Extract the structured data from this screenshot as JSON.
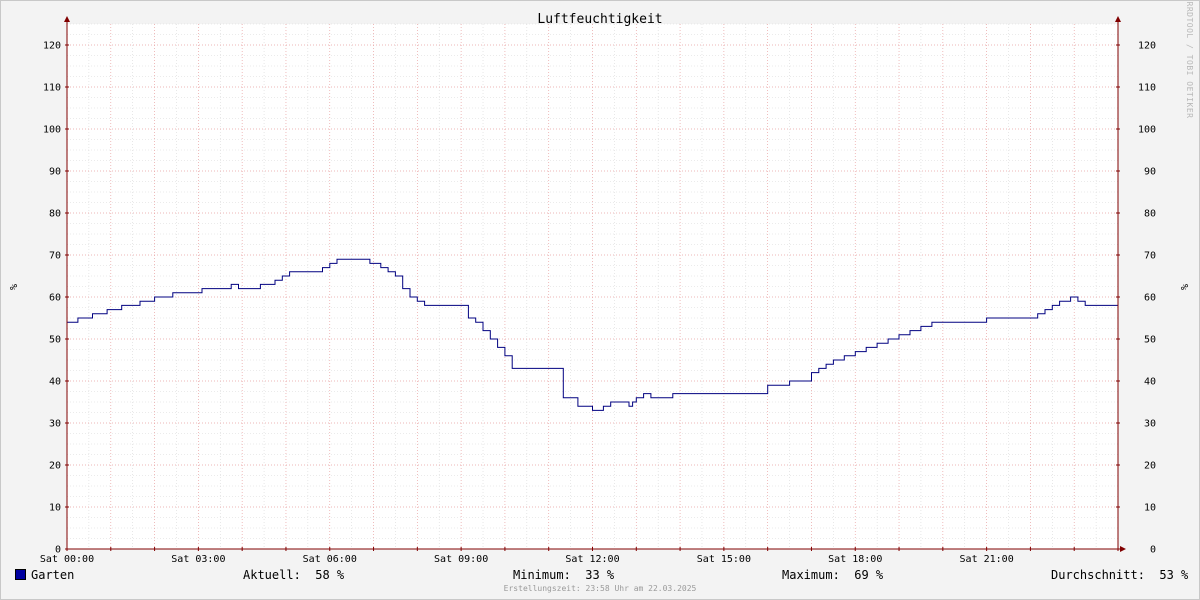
{
  "chart_data": {
    "type": "line",
    "title": "Luftfeuchtigkeit",
    "ylabel": "%",
    "ylim": [
      0,
      125
    ],
    "yticks": [
      0,
      10,
      20,
      30,
      40,
      50,
      60,
      70,
      80,
      90,
      100,
      110,
      120
    ],
    "xlim": [
      "Sat 00:00",
      "Sat 24:00"
    ],
    "xticks": [
      "Sat 00:00",
      "Sat 03:00",
      "Sat 06:00",
      "Sat 09:00",
      "Sat 12:00",
      "Sat 15:00",
      "Sat 18:00",
      "Sat 21:00"
    ],
    "grid": true,
    "series": [
      {
        "name": "Garten",
        "color": "#000080",
        "x": [
          "00:00",
          "00:15",
          "00:35",
          "00:55",
          "01:15",
          "01:40",
          "02:00",
          "02:25",
          "02:55",
          "03:05",
          "03:30",
          "03:45",
          "03:55",
          "04:25",
          "04:35",
          "04:45",
          "04:55",
          "05:05",
          "05:35",
          "05:50",
          "06:00",
          "06:10",
          "06:40",
          "06:50",
          "06:55",
          "07:00",
          "07:10",
          "07:20",
          "07:30",
          "07:40",
          "07:50",
          "08:00",
          "08:10",
          "08:20",
          "08:40",
          "09:00",
          "09:10",
          "09:20",
          "09:30",
          "09:40",
          "09:50",
          "10:00",
          "10:10",
          "10:20",
          "10:30",
          "10:40",
          "11:00",
          "11:20",
          "11:40",
          "12:00",
          "12:10",
          "12:15",
          "12:25",
          "12:40",
          "12:50",
          "12:55",
          "13:00",
          "13:10",
          "13:20",
          "13:30",
          "13:40",
          "13:50",
          "14:00",
          "14:10",
          "14:20",
          "14:30",
          "15:00",
          "15:30",
          "16:00",
          "16:30",
          "17:00",
          "17:10",
          "17:20",
          "17:30",
          "17:45",
          "18:00",
          "18:15",
          "18:30",
          "18:45",
          "19:00",
          "19:15",
          "19:30",
          "19:45",
          "20:00",
          "20:15",
          "20:30",
          "21:00",
          "21:30",
          "22:00",
          "22:10",
          "22:20",
          "22:30",
          "22:40",
          "22:55",
          "23:05",
          "23:15",
          "23:30",
          "24:00"
        ],
        "values": [
          54,
          55,
          56,
          57,
          58,
          59,
          60,
          61,
          61,
          62,
          62,
          63,
          62,
          63,
          63,
          64,
          65,
          66,
          66,
          67,
          68,
          69,
          69,
          69,
          68,
          68,
          67,
          66,
          65,
          62,
          60,
          59,
          58,
          58,
          58,
          58,
          55,
          54,
          52,
          50,
          48,
          46,
          43,
          43,
          43,
          43,
          43,
          36,
          34,
          33,
          33,
          34,
          35,
          35,
          34,
          35,
          36,
          37,
          36,
          36,
          36,
          37,
          37,
          37,
          37,
          37,
          37,
          37,
          39,
          40,
          42,
          43,
          44,
          45,
          46,
          47,
          48,
          49,
          50,
          51,
          52,
          53,
          54,
          54,
          54,
          54,
          55,
          55,
          55,
          56,
          57,
          58,
          59,
          60,
          59,
          58,
          58,
          58
        ]
      }
    ]
  },
  "watermark": "RRDTOOL / TOBI OETIKER",
  "legend": {
    "series_name": "Garten",
    "current_label": "Aktuell:",
    "current_value": "58 %",
    "min_label": "Minimum:",
    "min_value": "33 %",
    "max_label": "Maximum:",
    "max_value": "69 %",
    "avg_label": "Durchschnitt:",
    "avg_value": "53 %"
  },
  "footer": "Erstellungszeit: 23:58 Uhr am 22.03.2025",
  "colors": {
    "line": "#000080",
    "major_grid": "#e8a0a0",
    "minor_grid": "#d8d8d8",
    "axis": "#800000",
    "plot_background": "#ffffff",
    "canvas": "#f3f3f3"
  }
}
